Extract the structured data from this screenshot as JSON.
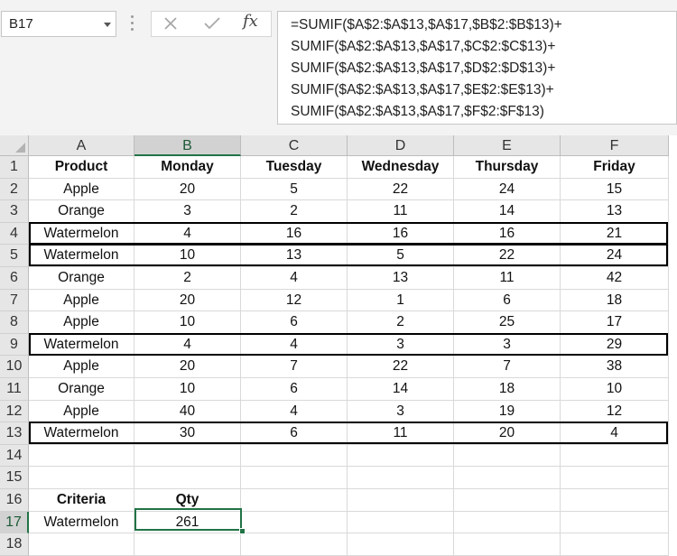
{
  "name_box": {
    "value": "B17"
  },
  "formula_bar": {
    "lines": [
      "=SUMIF($A$2:$A$13,$A$17,$B$2:$B$13)+",
      "SUMIF($A$2:$A$13,$A$17,$C$2:$C$13)+",
      "SUMIF($A$2:$A$13,$A$17,$D$2:$D$13)+",
      "SUMIF($A$2:$A$13,$A$17,$E$2:$E$13)+",
      "SUMIF($A$2:$A$13,$A$17,$F$2:$F$13)"
    ],
    "fx_label": "fx"
  },
  "columns": [
    "A",
    "B",
    "C",
    "D",
    "E",
    "F"
  ],
  "row_numbers": [
    "1",
    "2",
    "3",
    "4",
    "5",
    "6",
    "7",
    "8",
    "9",
    "10",
    "11",
    "12",
    "13",
    "14",
    "15",
    "16",
    "17",
    "18"
  ],
  "rows": [
    [
      "Product",
      "Monday",
      "Tuesday",
      "Wednesday",
      "Thursday",
      "Friday"
    ],
    [
      "Apple",
      "20",
      "5",
      "22",
      "24",
      "15"
    ],
    [
      "Orange",
      "3",
      "2",
      "11",
      "14",
      "13"
    ],
    [
      "Watermelon",
      "4",
      "16",
      "16",
      "16",
      "21"
    ],
    [
      "Watermelon",
      "10",
      "13",
      "5",
      "22",
      "24"
    ],
    [
      "Orange",
      "2",
      "4",
      "13",
      "11",
      "42"
    ],
    [
      "Apple",
      "20",
      "12",
      "1",
      "6",
      "18"
    ],
    [
      "Apple",
      "10",
      "6",
      "2",
      "25",
      "17"
    ],
    [
      "Watermelon",
      "4",
      "4",
      "3",
      "3",
      "29"
    ],
    [
      "Apple",
      "20",
      "7",
      "22",
      "7",
      "38"
    ],
    [
      "Orange",
      "10",
      "6",
      "14",
      "18",
      "10"
    ],
    [
      "Apple",
      "40",
      "4",
      "3",
      "19",
      "12"
    ],
    [
      "Watermelon",
      "30",
      "6",
      "11",
      "20",
      "4"
    ],
    [
      "",
      "",
      "",
      "",
      "",
      ""
    ],
    [
      "",
      "",
      "",
      "",
      "",
      ""
    ],
    [
      "Criteria",
      "Qty",
      "",
      "",
      "",
      ""
    ],
    [
      "Watermelon",
      "261",
      "",
      "",
      "",
      ""
    ],
    [
      "",
      "",
      "",
      "",
      "",
      ""
    ]
  ],
  "bold_rows": [
    1,
    16
  ],
  "highlighted_rows": [
    4,
    5,
    9,
    13
  ],
  "active_cell": "B17",
  "colors": {
    "accent": "#217346",
    "header_bg": "#e6e6e6",
    "gridline": "#d9d9d9"
  }
}
